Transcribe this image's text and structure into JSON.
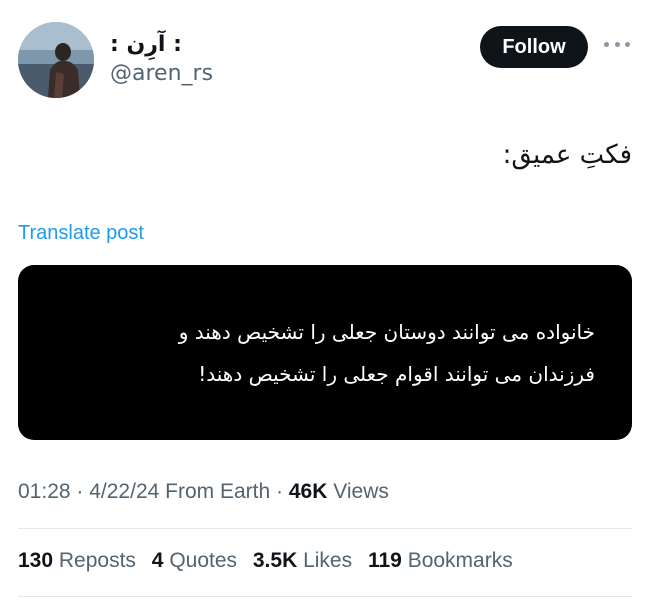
{
  "author": {
    "display_name": "꞉ آرِن ꞉",
    "handle": "@aren_rs",
    "avatar_icon": "profile-photo"
  },
  "actions": {
    "follow_label": "Follow",
    "more_icon": "more-horizontal-icon"
  },
  "post": {
    "text": "فکتِ عمیق:",
    "translate_label": "Translate post",
    "media_lines": [
      "خانواده می توانند دوستان جعلی را تشخیص دهند و",
      "فرزندان می توانند اقوام جعلی را تشخیص دهند!"
    ]
  },
  "meta": {
    "time": "01:28",
    "date": "4/22/24",
    "source": "From Earth",
    "views_count": "46K",
    "views_label": "Views"
  },
  "stats": [
    {
      "count": "130",
      "label": "Reposts"
    },
    {
      "count": "4",
      "label": "Quotes"
    },
    {
      "count": "3.5K",
      "label": "Likes"
    },
    {
      "count": "119",
      "label": "Bookmarks"
    }
  ],
  "colors": {
    "text": "#0f1419",
    "secondary": "#536471",
    "link": "#1d9bf0",
    "button_bg": "#0f1419"
  }
}
